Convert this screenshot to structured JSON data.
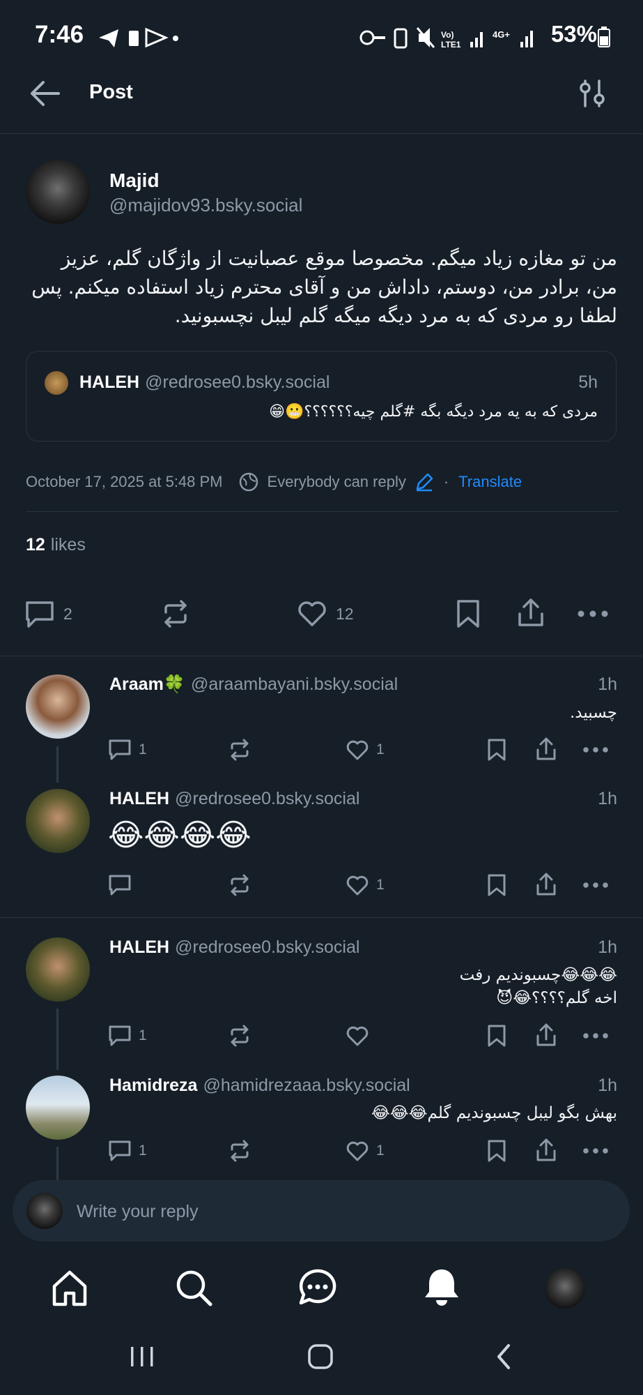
{
  "status_bar": {
    "time": "7:46",
    "battery": "53%",
    "signal_label": "4G+"
  },
  "header": {
    "title": "Post"
  },
  "post": {
    "author_name": "Majid",
    "author_handle": "@majidov93.bsky.social",
    "text": "من تو مغازه زیاد میگم. مخصوصا موقع عصبانیت از واژگان گلم، عزیز من، برادر من، دوستم، داداش من و آقای محترم زیاد استفاده میکنم. پس لطفا رو مردی که به مرد دیگه میگه گلم لیبل نچسبونید.",
    "quote": {
      "author_name": "HALEH",
      "author_handle": "@redrosee0.bsky.social",
      "time": "5h",
      "text": "مردی که به یه مرد دیگه بگه #گلم  چیه؟؟؟؟؟؟😬😁"
    },
    "date": "October 17, 2025 at 5:48 PM",
    "reply_setting": "Everybody can reply",
    "translate_label": "Translate",
    "likes_count": "12",
    "likes_label": "likes",
    "actions": {
      "replies": "2",
      "likes": "12"
    }
  },
  "replies": [
    {
      "name": "Araam🍀",
      "handle": "@araambayani.bsky.social",
      "time": "1h",
      "text": "چسبید.",
      "reply_count": "1",
      "like_count": "1"
    },
    {
      "name": "HALEH",
      "handle": "@redrosee0.bsky.social",
      "time": "1h",
      "text": "😂😂😂😂",
      "reply_count": "",
      "like_count": "1"
    },
    {
      "name": "HALEH",
      "handle": "@redrosee0.bsky.social",
      "time": "1h",
      "text_line1": "😂😂😂چسبوندیم رفت",
      "text_line2": "اخه گلم؟؟؟؟😂😈",
      "reply_count": "1",
      "like_count": ""
    },
    {
      "name": "Hamidreza",
      "handle": "@hamidrezaaa.bsky.social",
      "time": "1h",
      "text": "بهش بگو لیبل چسبوندیم گلم😂😂😂",
      "reply_count": "1",
      "like_count": "1"
    }
  ],
  "composer": {
    "placeholder": "Write your reply"
  },
  "colors": {
    "background": "#161e27",
    "accent": "#208bfe",
    "muted": "#8d99a7",
    "divider": "#2a3440"
  },
  "icons": [
    "back-arrow-icon",
    "filter-icon",
    "globe-icon",
    "pencil-icon",
    "comment-icon",
    "repost-icon",
    "heart-icon",
    "bookmark-icon",
    "share-icon",
    "more-icon",
    "home-icon",
    "search-icon",
    "chat-icon",
    "bell-icon"
  ]
}
